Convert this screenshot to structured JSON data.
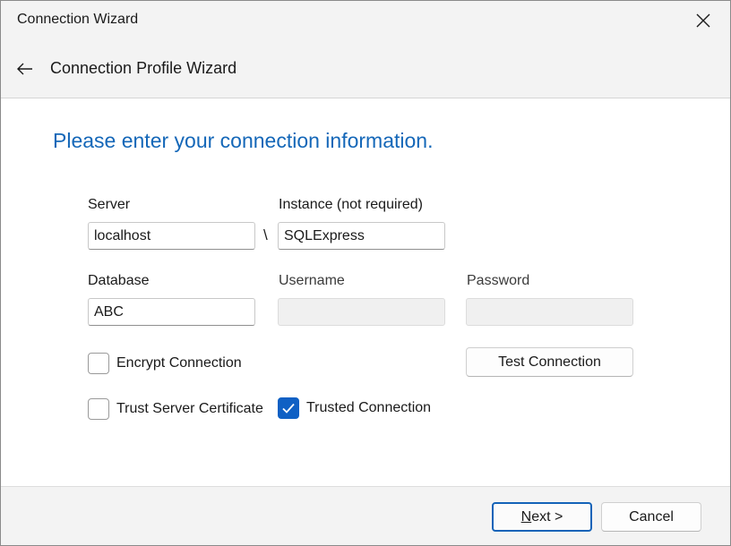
{
  "window": {
    "title": "Connection Wizard"
  },
  "nav": {
    "title": "Connection Profile Wizard"
  },
  "main": {
    "heading": "Please enter your connection information."
  },
  "fields": {
    "server": {
      "label": "Server",
      "value": "localhost"
    },
    "separator": "\\",
    "instance": {
      "label": "Instance (not required)",
      "value": "SQLExpress"
    },
    "database": {
      "label": "Database",
      "value": "ABC"
    },
    "username": {
      "label": "Username",
      "value": ""
    },
    "password": {
      "label": "Password",
      "value": ""
    }
  },
  "options": {
    "encrypt": {
      "label": "Encrypt Connection",
      "checked": false
    },
    "trust_cert": {
      "label": "Trust Server Certificate",
      "checked": false
    },
    "trusted": {
      "label": "Trusted Connection",
      "checked": true
    }
  },
  "buttons": {
    "test": "Test Connection",
    "next": "Next >",
    "cancel": "Cancel"
  },
  "colors": {
    "accent": "#1467b8",
    "checkbox_checked": "#0f60c4"
  },
  "icons": {
    "close": "close-icon",
    "back": "back-arrow-icon",
    "check": "checkmark-icon"
  }
}
